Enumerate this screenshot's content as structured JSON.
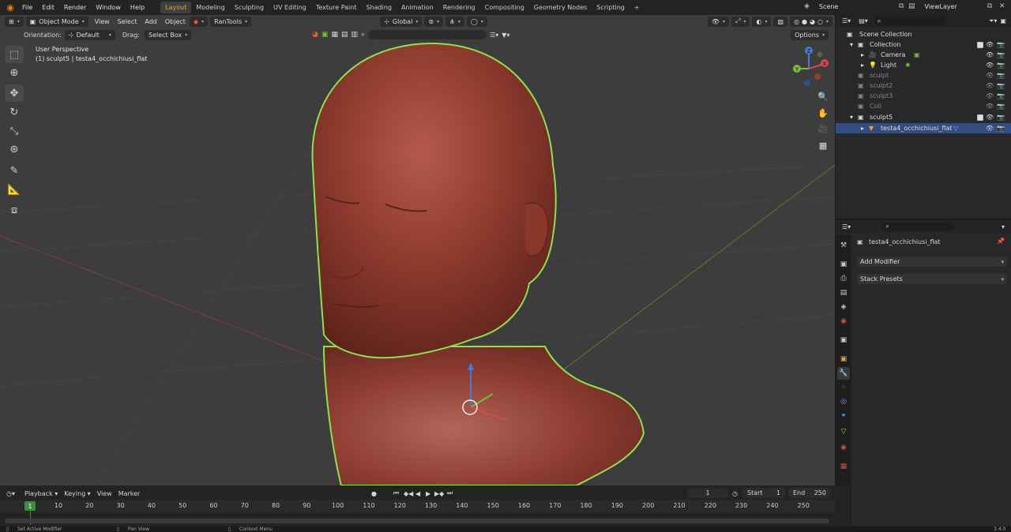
{
  "topbar": {
    "menus": [
      "File",
      "Edit",
      "Render",
      "Window",
      "Help"
    ],
    "workspaces": [
      "Layout",
      "Modeling",
      "Sculpting",
      "UV Editing",
      "Texture Paint",
      "Shading",
      "Animation",
      "Rendering",
      "Compositing",
      "Geometry Nodes",
      "Scripting"
    ],
    "active_workspace": "Layout",
    "add_tab": "+",
    "scene": "Scene",
    "view_layer": "ViewLayer"
  },
  "viewport_header": {
    "mode": "Object Mode",
    "menus": [
      "View",
      "Select",
      "Add",
      "Object"
    ],
    "addon": "RanTools",
    "transform_orientation": "Global"
  },
  "tool_settings": {
    "orientation_label": "Orientation:",
    "orientation_value": "Default",
    "drag_label": "Drag:",
    "drag_value": "Select Box",
    "options": "Options"
  },
  "viewport_overlay": {
    "view_name": "User Perspective",
    "object_info": "(1) sculpt5 | testa4_occhichiusi_flat"
  },
  "gizmo": {
    "x": "X",
    "y": "Y",
    "z": "Z"
  },
  "outliner": {
    "items": [
      {
        "label": "Scene Collection"
      },
      {
        "label": "Collection"
      },
      {
        "label": "Camera"
      },
      {
        "label": "Light"
      },
      {
        "label": "sculpt"
      },
      {
        "label": "sculpt2"
      },
      {
        "label": "sculpt3"
      },
      {
        "label": "Coll"
      },
      {
        "label": "sculpt5"
      },
      {
        "label": "testa4_occhichiusi_flat"
      }
    ]
  },
  "properties": {
    "object_name": "testa4_occhichiusi_flat",
    "add_modifier": "Add Modifier",
    "stack_presets": "Stack Presets"
  },
  "timeline": {
    "menus": [
      "Playback",
      "Keying",
      "View",
      "Marker"
    ],
    "current_frame": "1",
    "start_label": "Start",
    "start_value": "1",
    "end_label": "End",
    "end_value": "250",
    "ticks": [
      "10",
      "20",
      "30",
      "40",
      "50",
      "60",
      "70",
      "80",
      "90",
      "100",
      "110",
      "120",
      "130",
      "140",
      "150",
      "160",
      "170",
      "180",
      "190",
      "200",
      "210",
      "220",
      "230",
      "240",
      "250"
    ],
    "playhead": "1"
  },
  "status": {
    "left": "Set Active Modifier",
    "middle": "Pan View",
    "right": "Context Menu",
    "version": "3.4.0"
  },
  "colors": {
    "accent": "#e6a23c",
    "selection_outline": "#7fd648",
    "skin": "#8e3a2e",
    "selected_row": "#334d80"
  }
}
